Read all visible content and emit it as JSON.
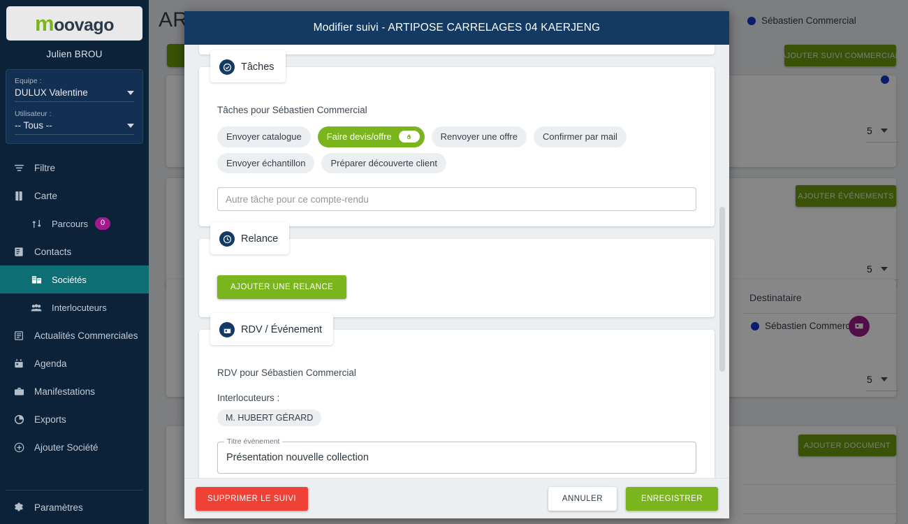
{
  "sidebar": {
    "logo": {
      "prefix": "m",
      "rest": "oovago"
    },
    "user_name": "Julien BROU",
    "filters": {
      "team_label": "Equipe :",
      "team_value": "DULUX Valentine",
      "user_label": "Utilisateur :",
      "user_value": "-- Tous --"
    },
    "items": [
      {
        "label": "Filtre",
        "icon": "filter-icon",
        "level": 0,
        "active": false
      },
      {
        "label": "Carte",
        "icon": "map-icon",
        "level": 0,
        "active": false
      },
      {
        "label": "Parcours",
        "icon": "route-icon",
        "level": 1,
        "active": false,
        "badge": "0"
      },
      {
        "label": "Contacts",
        "icon": "contacts-icon",
        "level": 0,
        "active": false
      },
      {
        "label": "Sociétés",
        "icon": "building-icon",
        "level": 1,
        "active": true
      },
      {
        "label": "Interlocuteurs",
        "icon": "people-icon",
        "level": 1,
        "active": false
      },
      {
        "label": "Actualités Commerciales",
        "icon": "news-icon",
        "level": 0,
        "active": false
      },
      {
        "label": "Agenda",
        "icon": "calendar-icon",
        "level": 0,
        "active": false
      },
      {
        "label": "Manifestations",
        "icon": "briefcase-icon",
        "level": 0,
        "active": false
      },
      {
        "label": "Exports",
        "icon": "pie-chart-icon",
        "level": 0,
        "active": false
      },
      {
        "label": "Ajouter Société",
        "icon": "plus-circle-icon",
        "level": 0,
        "active": false
      }
    ],
    "settings_label": "Paramètres",
    "settings_icon": "gear-icon"
  },
  "background": {
    "page_title": "AR",
    "back_button_icon": "arrow-left-icon",
    "owner_name": "Sébastien Commercial",
    "btn_add_suivi": "AJOUTER SUIVI COMMERCIAL",
    "btn_add_events": "AJOUTER ÉVÉNEMENTS",
    "btn_add_document": "AJOUTER DOCUMENT",
    "column_recipient": "Destinataire",
    "recipient_name": "Sébastien Commercial",
    "recipient_action_icon": "calendar-event-icon",
    "per_page_1": "5",
    "per_page_2": "5",
    "per_page_3": "5"
  },
  "modal": {
    "title": "Modifier suivi - ARTIPOSE CARRELAGES 04 KAERJENG",
    "sections": {
      "taches": {
        "title": "Tâches",
        "icon": "check-circle-icon",
        "subtitle": "Tâches pour Sébastien Commercial",
        "chips": [
          {
            "label": "Envoyer catalogue",
            "selected": false
          },
          {
            "label": "Faire devis/offre",
            "selected": true
          },
          {
            "label": "Renvoyer une offre",
            "selected": false
          },
          {
            "label": "Confirmer par mail",
            "selected": false
          },
          {
            "label": "Envoyer échantillon",
            "selected": false
          },
          {
            "label": "Préparer découverte client",
            "selected": false
          }
        ],
        "other_task_placeholder": "Autre tâche pour ce compte-rendu",
        "other_task_value": ""
      },
      "relance": {
        "title": "Relance",
        "icon": "clock-icon",
        "add_button": "AJOUTER UNE RELANCE"
      },
      "rdv": {
        "title": "RDV / Événement",
        "icon": "calendar-event-icon",
        "subtitle": "RDV pour Sébastien Commercial",
        "interlocuteurs_label": "Interlocuteurs :",
        "interlocuteurs": [
          "M. HUBERT GÉRARD"
        ],
        "title_field_legend": "Titre évènement",
        "title_field_value": "Présentation nouvelle collection"
      }
    },
    "footer": {
      "delete_label": "SUPPRIMER LE SUIVI",
      "cancel_label": "ANNULER",
      "save_label": "ENREGISTRER"
    }
  },
  "colors": {
    "sidebar_bg": "#0b2239",
    "sidebar_active": "#0d6e73",
    "brand_green": "#7ab51d",
    "modal_header": "#123a63",
    "danger_red": "#ef4136",
    "badge_purple": "#a01c8c",
    "dot_blue": "#1438c8"
  }
}
